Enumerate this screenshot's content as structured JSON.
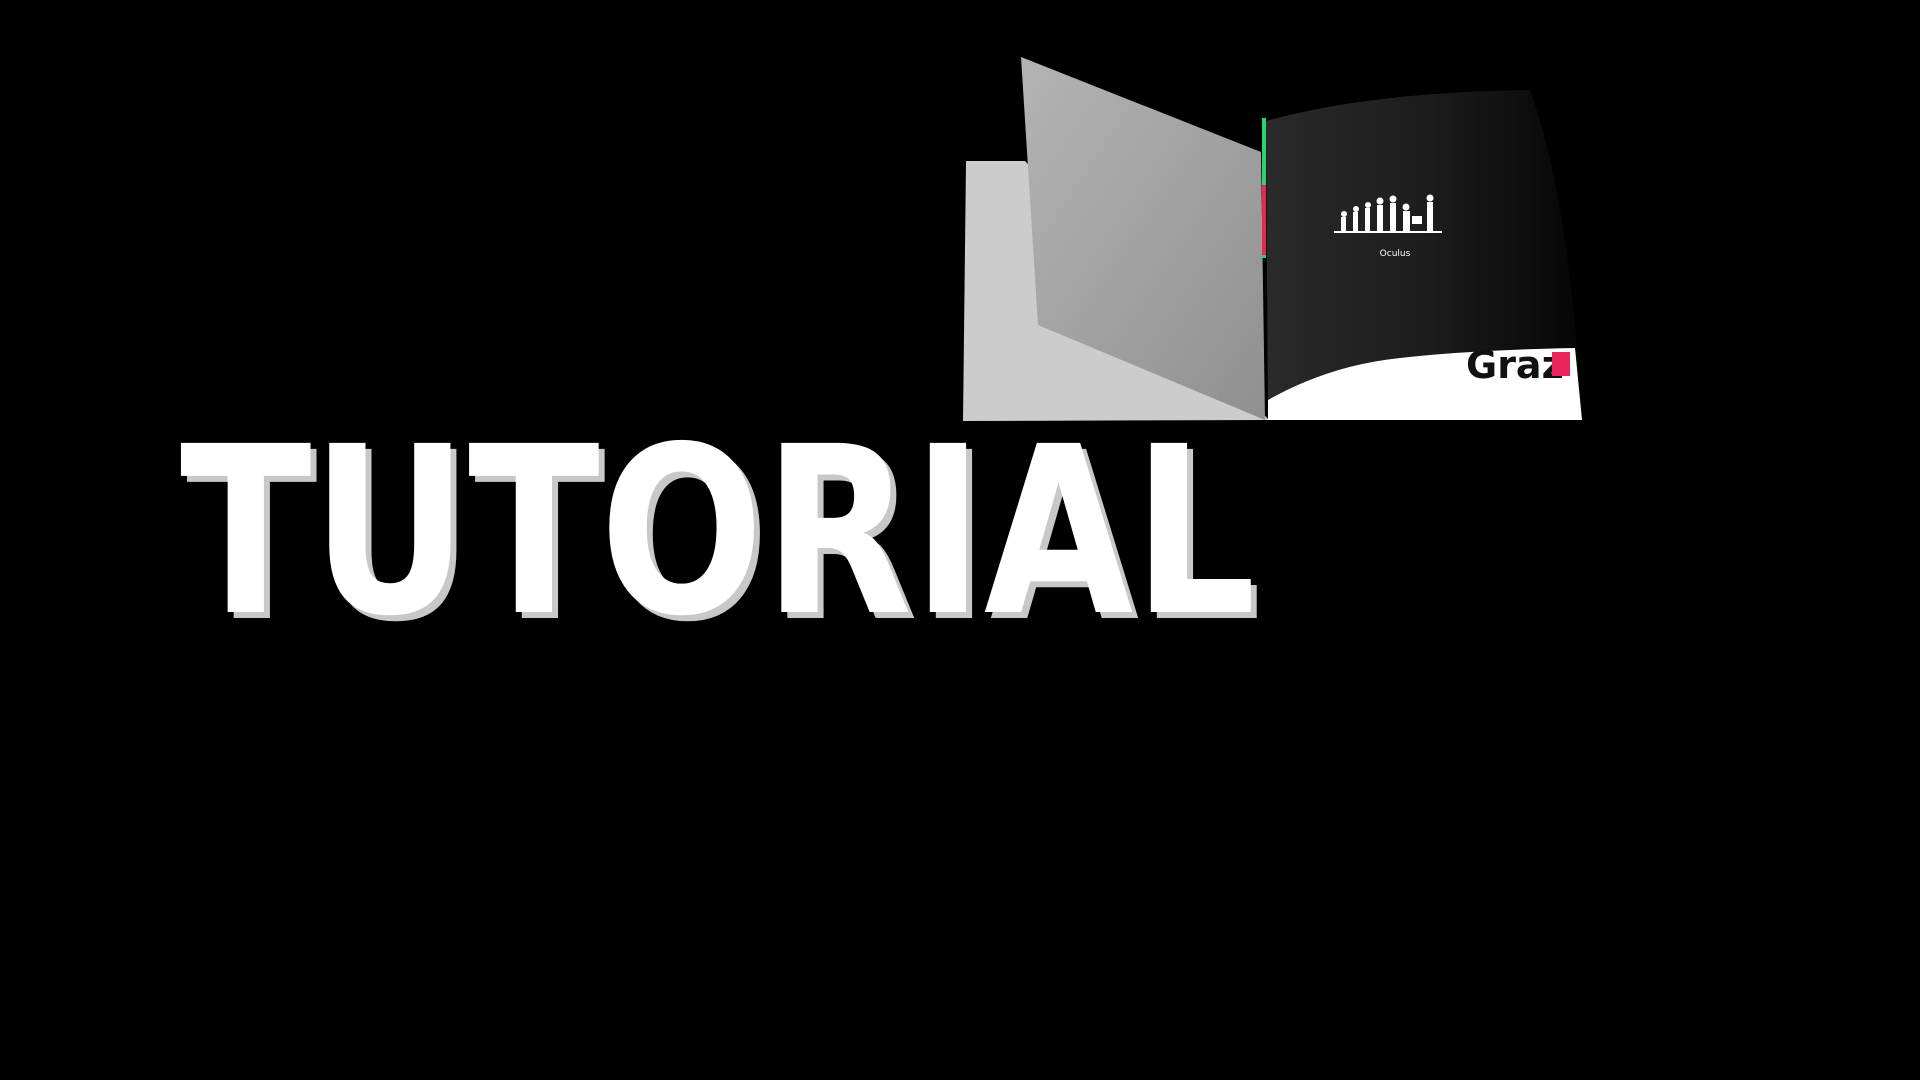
{
  "scene": {
    "background_color": "#000000",
    "title_text": "TUTORIAL",
    "title_color": "#ffffff",
    "title_edge_color": "#c8c8c8",
    "pink_accent_color": "#e8265c",
    "book": {
      "back_cover_color": "#cccccc",
      "turning_page_color": "#a6a6a6",
      "right_page_color": "#1a1a1a",
      "right_page_caption": "Oculus",
      "right_page_bottom_text": "Graz",
      "right_page_icon": "evolution-silhouette-icon"
    }
  }
}
